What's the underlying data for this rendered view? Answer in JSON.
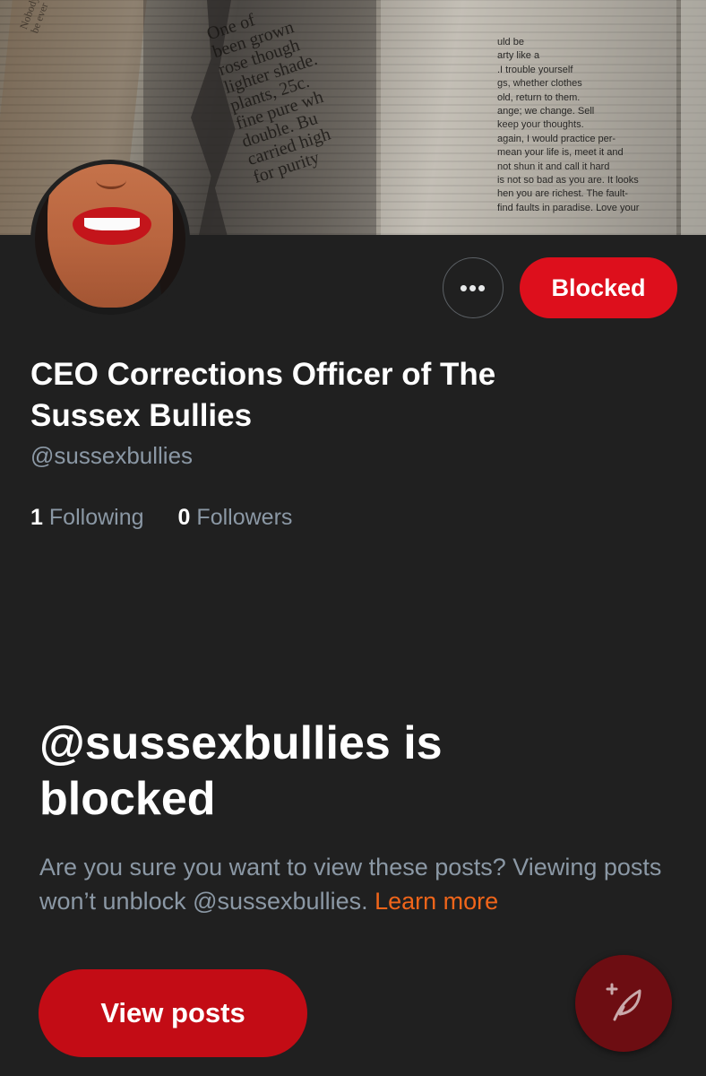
{
  "profile": {
    "display_name": "CEO Corrections Officer of The Sussex Bullies",
    "handle": "@sussexbullies",
    "following_count": "1",
    "following_label": "Following",
    "followers_count": "0",
    "followers_label": "Followers"
  },
  "actions": {
    "more_label": "•••",
    "blocked_label": "Blocked"
  },
  "blocked_notice": {
    "title": "@sussexbullies is blocked",
    "description": "Are you sure you want to view these posts? Viewing posts won’t unblock @sussexbullies.",
    "learn_more": "Learn more",
    "view_posts_label": "View posts"
  },
  "banner": {
    "text_1": "One of\nbeen grown\nrose though\nlighter shade.\nplants, 25c.\nfine pure wh\ndouble. Bu\ncarried high\nfor purity",
    "text_2": "uld be\narty like a\n.I trouble yourself\ngs, whether clothes\nold, return to them.\nange; we change. Sell\nkeep your thoughts.\nagain, I would practice per-\nmean your life is, meet it and\nnot shun it and call it hard\nis not so bad as you are. It looks\nhen you are richest. The fault-\nfind faults in paradise. Love your",
    "text_3": "Nobody will\nbe ever"
  },
  "icons": {
    "compose": "compose-post-icon"
  },
  "colors": {
    "background": "#202020",
    "accent_red": "#dd0f1c",
    "link_orange": "#f0651a",
    "muted_text": "#8b98a5"
  }
}
